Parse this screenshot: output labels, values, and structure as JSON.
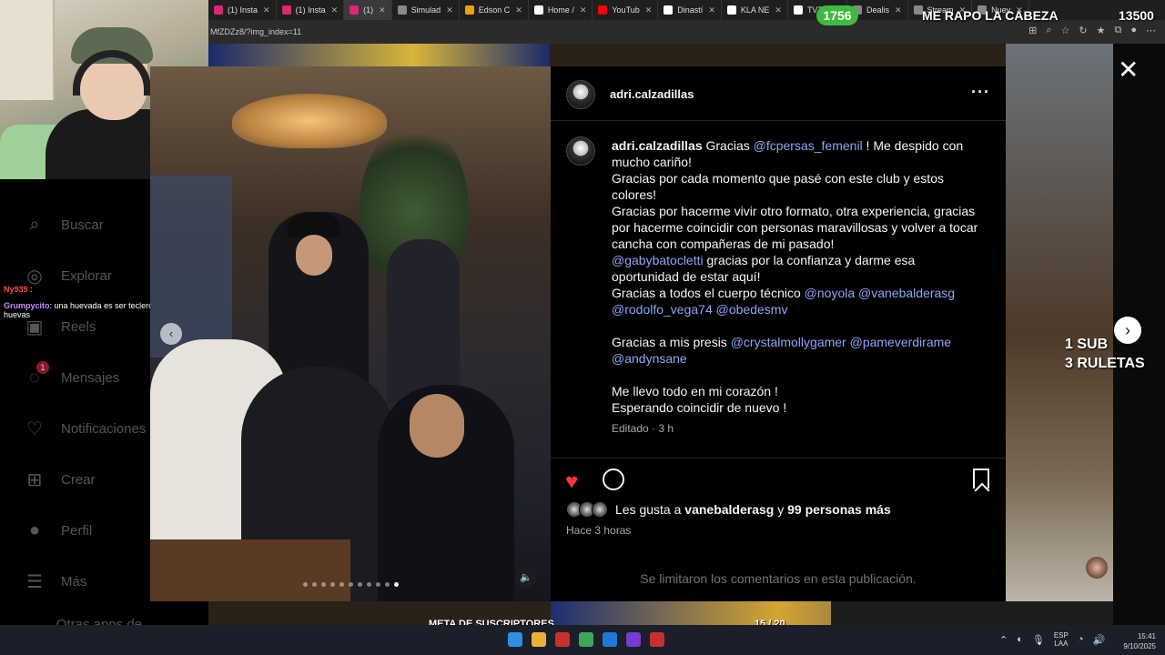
{
  "browser": {
    "tabs": [
      {
        "label": "(1) Insta",
        "color": "#d62976"
      },
      {
        "label": "(1) Insta",
        "color": "#d62976"
      },
      {
        "label": "(1)",
        "color": "#d62976",
        "active": true
      },
      {
        "label": "Simulad",
        "color": "#888888"
      },
      {
        "label": "Edson C",
        "color": "#e8a400"
      },
      {
        "label": "Home /",
        "color": "#ffffff"
      },
      {
        "label": "YouTub",
        "color": "#ff0000"
      },
      {
        "label": "Dinastí",
        "color": "#ffffff"
      },
      {
        "label": "KLA NE",
        "color": "#ffffff"
      },
      {
        "label": "TVTC",
        "color": "#ffffff"
      },
      {
        "label": "Dealis",
        "color": "#888888"
      },
      {
        "label": "Stream",
        "color": "#888888"
      },
      {
        "label": "Nuev",
        "color": "#888888"
      }
    ],
    "url": "MfZDZz8/?img_index=11"
  },
  "stream": {
    "counter": "1756",
    "goal_text": "ME RAPO LA CABEZA",
    "goal_number": "13500",
    "sub_line1": "1 SUB",
    "sub_line2": "3 RULETAS",
    "sub_goal_label": "META DE SUSCRIPTORES",
    "sub_goal_count": "15  / 20",
    "sub_goal_progress": 0.75
  },
  "chat": [
    {
      "user": "Ny939",
      "text": ":",
      "color": "#ff4a4a"
    },
    {
      "user": "Grumpycito",
      "text": ": una huevada es ser teclero y otra es teclear huevas",
      "color": "#c48cff"
    }
  ],
  "sidebar": {
    "items": [
      {
        "label": "Buscar",
        "icon": "search-icon",
        "glyph": "⌕"
      },
      {
        "label": "Explorar",
        "icon": "compass-icon",
        "glyph": "◎"
      },
      {
        "label": "Reels",
        "icon": "reels-icon",
        "glyph": "▣"
      },
      {
        "label": "Mensajes",
        "icon": "messenger-icon",
        "glyph": "◌",
        "badge": "1"
      },
      {
        "label": "Notificaciones",
        "icon": "heart-icon",
        "glyph": "♡"
      },
      {
        "label": "Crear",
        "icon": "plus-square-icon",
        "glyph": "⊞"
      },
      {
        "label": "Perfil",
        "icon": "avatar-icon",
        "glyph": "●"
      },
      {
        "label": "Más",
        "icon": "menu-icon",
        "glyph": "☰"
      },
      {
        "label": "Otras apps de Meta",
        "icon": "meta-apps-icon",
        "glyph": "⧉"
      }
    ]
  },
  "post": {
    "username": "adri.calzadillas",
    "caption": {
      "username": "adri.calzadillas",
      "lines": [
        [
          {
            "t": " Gracias "
          },
          {
            "m": "@fcpersas_femenil"
          },
          {
            "t": " ! Me despido con mucho cariño!"
          }
        ],
        [
          {
            "t": "Gracias por cada momento que pasé con este club y estos colores!"
          }
        ],
        [
          {
            "t": "Gracias por hacerme vivir otro formato, otra experiencia, gracias por hacerme coincidir con personas maravillosas y volver a tocar cancha con compañeras de mi pasado!"
          }
        ],
        [
          {
            "m": "@gabybatocletti"
          },
          {
            "t": " gracias por la confianza y darme esa oportunidad de estar aquí!"
          }
        ],
        [
          {
            "t": "Gracias a todos el cuerpo técnico "
          },
          {
            "m": "@noyola"
          },
          {
            "t": " "
          },
          {
            "m": "@vanebalderasg"
          },
          {
            "t": " "
          },
          {
            "m": "@rodolfo_vega74"
          },
          {
            "t": " "
          },
          {
            "m": "@obedesmv"
          }
        ],
        [],
        [
          {
            "t": "Gracias a mis presis "
          },
          {
            "m": "@crystalmollygamer"
          },
          {
            "t": " "
          },
          {
            "m": "@pameverdirame"
          },
          {
            "t": " "
          },
          {
            "m": "@andynsane"
          }
        ],
        [],
        [
          {
            "t": "Me llevo todo en mi corazón !"
          }
        ],
        [
          {
            "t": "Esperando coincidir de nuevo !"
          }
        ]
      ]
    },
    "edited": "Editado · 3 h",
    "likes_prefix": "Les gusta a ",
    "likes_user": "vanebalderasg",
    "likes_mid": " y ",
    "likes_others": "99 personas más",
    "posted": "Hace 3 horas",
    "comments_limited": "Se limitaron los comentarios en esta publicación.",
    "carousel": {
      "total": 11,
      "current": 11
    }
  },
  "taskbar": {
    "lang_top": "ESP",
    "lang_bottom": "LAA",
    "time": "15:41",
    "date": "9/10/2025"
  }
}
